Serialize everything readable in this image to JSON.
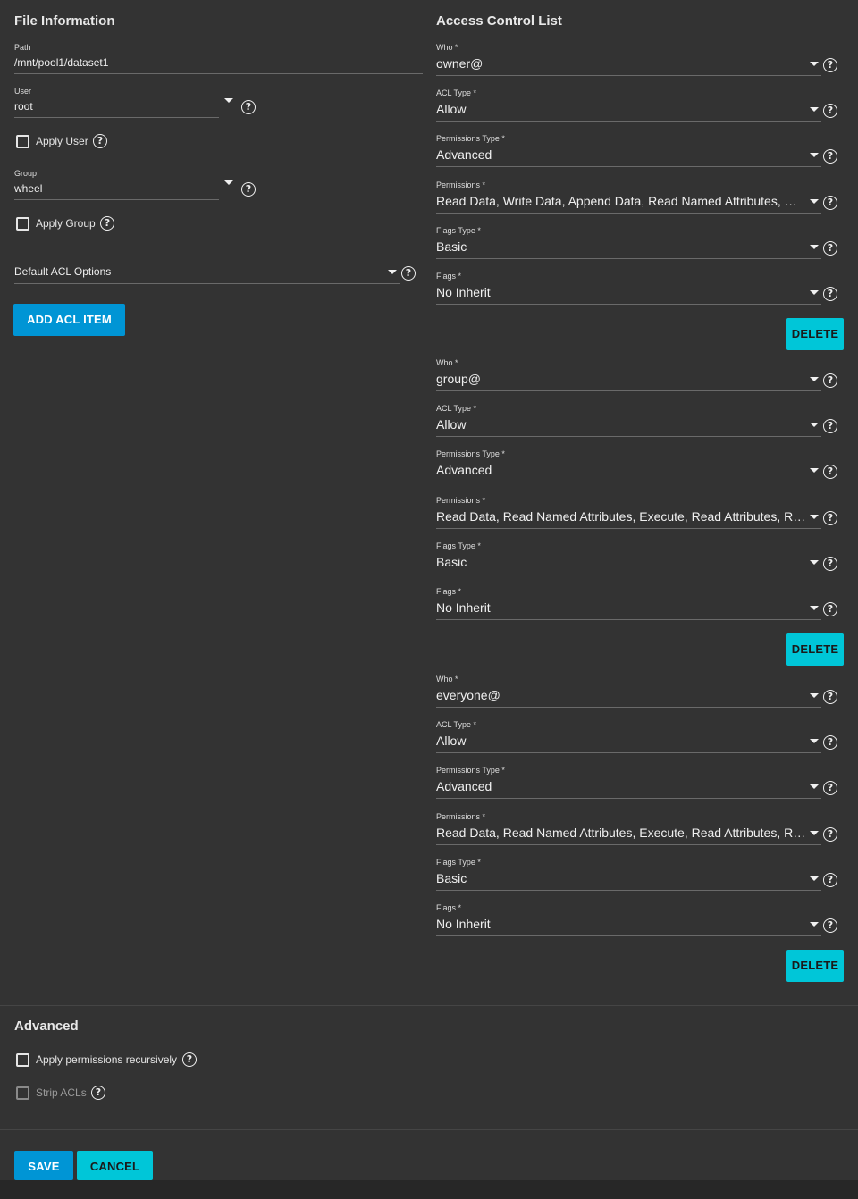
{
  "file_info": {
    "title": "File Information",
    "path": {
      "label": "Path",
      "value": "/mnt/pool1/dataset1"
    },
    "user": {
      "label": "User",
      "value": "root"
    },
    "apply_user": {
      "label": "Apply User",
      "checked": false
    },
    "group": {
      "label": "Group",
      "value": "wheel"
    },
    "apply_group": {
      "label": "Apply Group",
      "checked": false
    },
    "default_acl": {
      "placeholder": "Default ACL Options"
    },
    "add_button": "ADD ACL ITEM"
  },
  "acl": {
    "title": "Access Control List",
    "labels": {
      "who": "Who *",
      "acl_type": "ACL Type *",
      "perm_type": "Permissions Type *",
      "permissions": "Permissions *",
      "flags_type": "Flags Type *",
      "flags": "Flags *"
    },
    "delete_label": "DELETE",
    "items": [
      {
        "who": "owner@",
        "acl_type": "Allow",
        "perm_type": "Advanced",
        "permissions": "Read Data, Write Data, Append Data, Read Named Attributes, Wri…",
        "flags_type": "Basic",
        "flags": "No Inherit"
      },
      {
        "who": "group@",
        "acl_type": "Allow",
        "perm_type": "Advanced",
        "permissions": "Read Data, Read Named Attributes, Execute, Read Attributes, Rea…",
        "flags_type": "Basic",
        "flags": "No Inherit"
      },
      {
        "who": "everyone@",
        "acl_type": "Allow",
        "perm_type": "Advanced",
        "permissions": "Read Data, Read Named Attributes, Execute, Read Attributes, Rea…",
        "flags_type": "Basic",
        "flags": "No Inherit"
      }
    ]
  },
  "advanced": {
    "title": "Advanced",
    "recursive": {
      "label": "Apply permissions recursively",
      "checked": false
    },
    "strip": {
      "label": "Strip ACLs",
      "checked": false,
      "disabled": true
    }
  },
  "footer": {
    "save": "SAVE",
    "cancel": "CANCEL"
  },
  "icons": {
    "help": "help-circle-icon",
    "dropdown": "caret-down-icon",
    "checkbox": "checkbox-unchecked-icon"
  },
  "colors": {
    "primary": "#0095d5",
    "accent": "#00c6d8",
    "background": "#333333"
  }
}
